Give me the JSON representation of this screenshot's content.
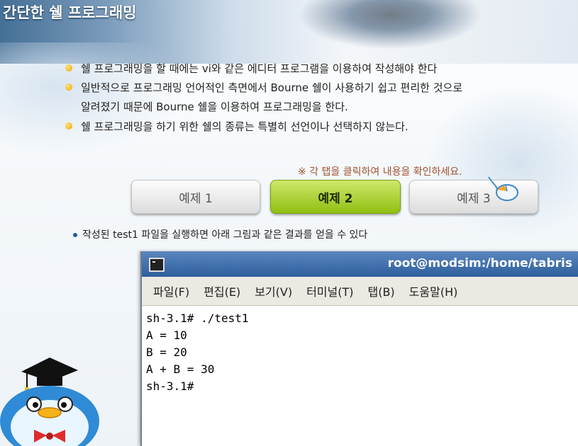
{
  "header": {
    "title": "간단한 쉘 프로그래밍"
  },
  "bullets": [
    "쉘 프로그래밍을 할 때에는 vi와 같은 에디터 프로그램을 이용하여 작성해야 한다",
    "일반적으로 프로그래밍 언어적인 측면에서 Bourne 쉘이 사용하기 쉽고 편리한 것으로",
    "알려졌기 때문에 Bourne 쉘을 이용하여 프로그래밍을 한다.",
    "쉘 프로그래밍을 하기 위한 쉘의 종류는 특별히 선언이나 선택하지 않는다."
  ],
  "tab_hint": "※ 각 탭을 클릭하여 내용을 확인하세요.",
  "tabs": [
    {
      "label": "예제 1"
    },
    {
      "label": "예제 2",
      "active": true
    },
    {
      "label": "예제 3"
    }
  ],
  "note": "작성된 test1 파일을 실행하면 아래 그림과 같은 결과를 얻을 수 있다",
  "terminal": {
    "title": "root@modsim:/home/tabris",
    "menu": [
      "파일(F)",
      "편집(E)",
      "보기(V)",
      "터미널(T)",
      "탭(B)",
      "도움말(H)"
    ],
    "lines": [
      "sh-3.1# ./test1",
      "A = 10",
      "B = 20",
      "A + B = 30",
      "sh-3.1#"
    ]
  },
  "colors": {
    "accent_active_tab": "#8fbf12",
    "hint_text": "#a0522d",
    "terminal_titlebar": "#2e5f9d"
  },
  "icons": [
    "terminal-icon",
    "mouse-cursor-icon",
    "penguin-mascot"
  ]
}
